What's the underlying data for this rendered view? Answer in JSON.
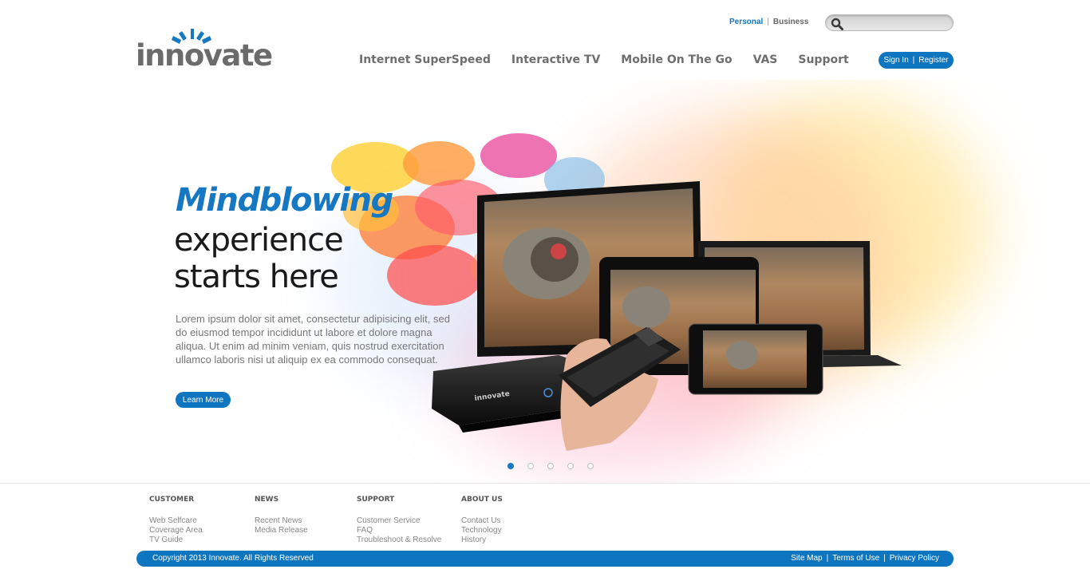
{
  "brand": {
    "logo_text": "innovate",
    "accent": "#1677c2"
  },
  "topbar": {
    "personal_label": "Personal",
    "separator": "|",
    "business_label": "Business",
    "search": {
      "placeholder": "",
      "value": ""
    }
  },
  "nav": {
    "items": [
      "Internet SuperSpeed",
      "Interactive TV",
      "Mobile On The Go",
      "VAS",
      "Support"
    ]
  },
  "auth": {
    "sign_in_label": "Sign In",
    "separator": "|",
    "register_label": "Register"
  },
  "hero": {
    "headline_accent": "Mindblowing",
    "headline_line2": "experience",
    "headline_line3": "starts here",
    "description": "Lorem ipsum dolor sit amet, consectetur adipisicing elit, sed do eiusmod tempor incididunt ut labore et dolore magna aliqua. Ut enim ad minim veniam, quis nostrud exercitation ullamco laboris nisi ut aliquip ex ea commodo consequat.",
    "cta_label": "Learn More",
    "device_brand_label": "innovate",
    "slides": {
      "count": 5,
      "active_index": 0
    }
  },
  "footer": {
    "columns": [
      {
        "title": "CUSTOMER",
        "links": [
          "Web Selfcare",
          "Coverage Area",
          "TV Guide"
        ]
      },
      {
        "title": "NEWS",
        "links": [
          "Recent News",
          "Media Release"
        ]
      },
      {
        "title": "SUPPORT",
        "links": [
          "Customer Service",
          "FAQ",
          "Troubleshoot & Resolve"
        ]
      },
      {
        "title": "ABOUT US",
        "links": [
          "Contact Us",
          "Technology",
          "History"
        ]
      }
    ],
    "copyright": "Copyright 2013 Innovate. All Rights Reserved",
    "bottom_links": [
      "Site Map",
      "Terms of Use",
      "Privacy Policy"
    ],
    "link_separator": "|"
  }
}
